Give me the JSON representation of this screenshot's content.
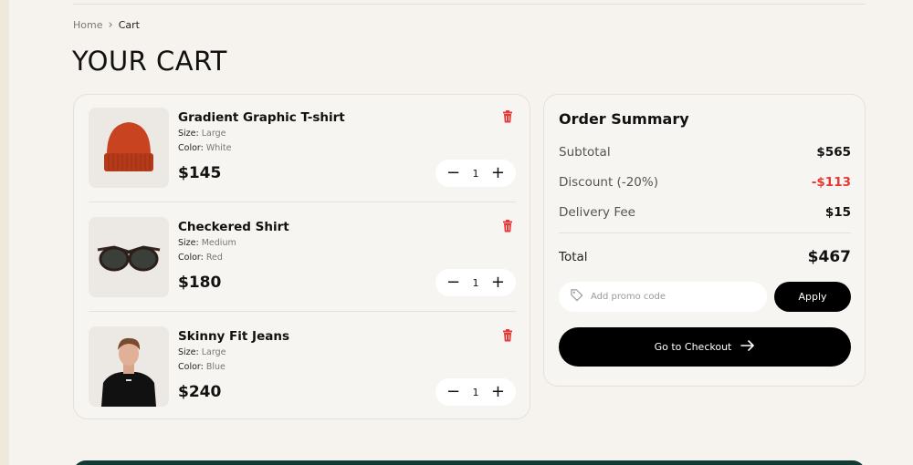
{
  "breadcrumb": {
    "home": "Home",
    "separator": "›",
    "current": "Cart"
  },
  "page_title": "YOUR CART",
  "cart": {
    "items": [
      {
        "name": "Gradient Graphic T-shirt",
        "size_label": "Size:",
        "size": "Large",
        "color_label": "Color:",
        "color": "White",
        "price": "$145",
        "quantity": "1",
        "thumbnail_icon": "red-beanie-image"
      },
      {
        "name": "Checkered Shirt",
        "size_label": "Size:",
        "size": "Medium",
        "color_label": "Color:",
        "color": "Red",
        "price": "$180",
        "quantity": "1",
        "thumbnail_icon": "sunglasses-image"
      },
      {
        "name": "Skinny Fit Jeans",
        "size_label": "Size:",
        "size": "Large",
        "color_label": "Color:",
        "color": "Blue",
        "price": "$240",
        "quantity": "1",
        "thumbnail_icon": "man-black-tshirt-image"
      }
    ],
    "minus_glyph": "−",
    "plus_glyph": "+"
  },
  "summary": {
    "title": "Order Summary",
    "rows": [
      {
        "label": "Subtotal",
        "value": "$565"
      },
      {
        "label": "Discount (-20%)",
        "value": "-$113"
      },
      {
        "label": "Delivery Fee",
        "value": "$15"
      }
    ],
    "total_label": "Total",
    "total_value": "$467",
    "promo_placeholder": "Add promo code",
    "apply_label": "Apply",
    "checkout_label": "Go to Checkout"
  },
  "colors": {
    "background": "#f6f3ee",
    "accent": "#000000",
    "discount": "#e53935",
    "delete_icon": "#e53935",
    "banner": "#0f3b34"
  }
}
